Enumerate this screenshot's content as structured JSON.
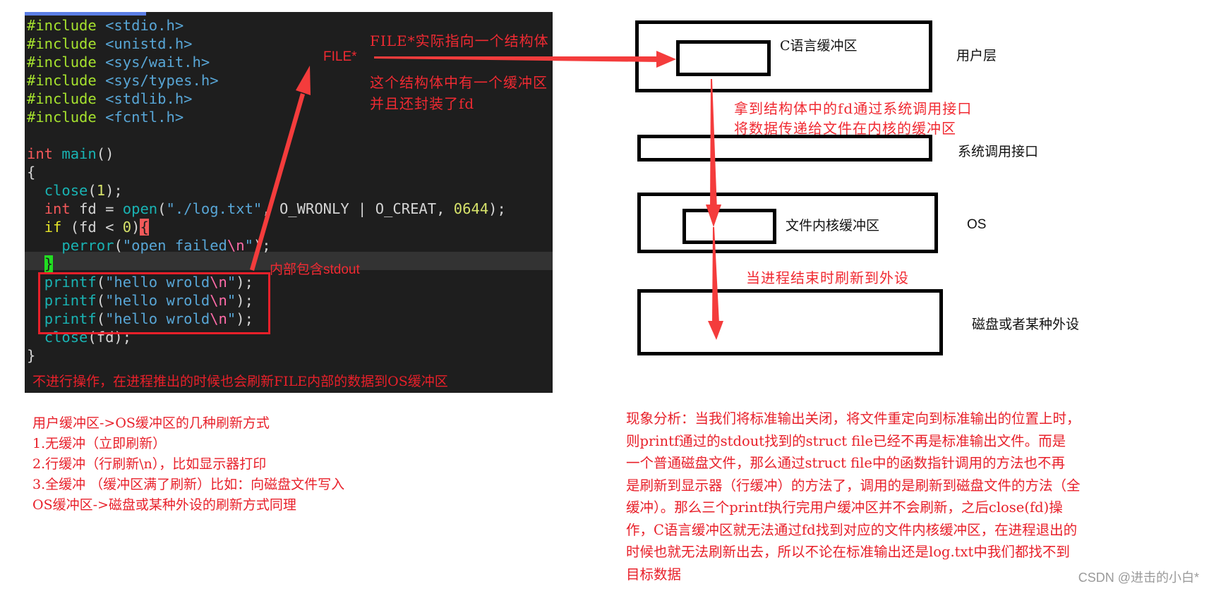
{
  "code": {
    "lines": [
      {
        "parts": [
          [
            "pp",
            "#include "
          ],
          [
            "hdr",
            "<stdio.h>"
          ]
        ]
      },
      {
        "parts": [
          [
            "pp",
            "#include "
          ],
          [
            "hdr",
            "<unistd.h>"
          ]
        ]
      },
      {
        "parts": [
          [
            "pp",
            "#include "
          ],
          [
            "hdr",
            "<sys/wait.h>"
          ]
        ]
      },
      {
        "parts": [
          [
            "pp",
            "#include "
          ],
          [
            "hdr",
            "<sys/types.h>"
          ]
        ]
      },
      {
        "parts": [
          [
            "pp",
            "#include "
          ],
          [
            "hdr",
            "<stdlib.h>"
          ]
        ]
      },
      {
        "parts": [
          [
            "pp",
            "#include "
          ],
          [
            "hdr",
            "<fcntl.h>"
          ]
        ]
      },
      {
        "parts": []
      },
      {
        "parts": [
          [
            "kw",
            "int "
          ],
          [
            "fn",
            "main"
          ],
          [
            "",
            "()"
          ]
        ]
      },
      {
        "parts": [
          [
            "",
            "{"
          ]
        ]
      },
      {
        "parts": [
          [
            "",
            "  "
          ],
          [
            "fn",
            "close"
          ],
          [
            "",
            "("
          ],
          [
            "num",
            "1"
          ],
          [
            "",
            ");"
          ]
        ]
      },
      {
        "parts": [
          [
            "",
            "  "
          ],
          [
            "kw",
            "int "
          ],
          [
            "",
            "fd = "
          ],
          [
            "fn",
            "open"
          ],
          [
            "",
            "("
          ],
          [
            "str",
            "\"./log.txt\""
          ],
          [
            "",
            ", O_WRONLY | O_CREAT, "
          ],
          [
            "num",
            "0644"
          ],
          [
            "",
            ");"
          ]
        ]
      },
      {
        "parts": [
          [
            "",
            "  "
          ],
          [
            "ctl",
            "if "
          ],
          [
            "",
            "(fd < "
          ],
          [
            "num",
            "0"
          ],
          [
            "",
            ")"
          ],
          [
            "brace-red",
            "{"
          ]
        ]
      },
      {
        "parts": [
          [
            "",
            "    "
          ],
          [
            "fn",
            "perror"
          ],
          [
            "",
            "("
          ],
          [
            "str",
            "\"open failed"
          ],
          [
            "esc",
            "\\n"
          ],
          [
            "str",
            "\""
          ],
          [
            "",
            ");"
          ]
        ]
      },
      {
        "parts": [
          [
            "",
            "  "
          ],
          [
            "brace-green",
            "}"
          ]
        ]
      },
      {
        "parts": [
          [
            "",
            "  "
          ],
          [
            "fn",
            "printf"
          ],
          [
            "",
            "("
          ],
          [
            "str",
            "\"hello wrold"
          ],
          [
            "esc",
            "\\n"
          ],
          [
            "str",
            "\""
          ],
          [
            "",
            ");"
          ]
        ]
      },
      {
        "parts": [
          [
            "",
            "  "
          ],
          [
            "fn",
            "printf"
          ],
          [
            "",
            "("
          ],
          [
            "str",
            "\"hello wrold"
          ],
          [
            "esc",
            "\\n"
          ],
          [
            "str",
            "\""
          ],
          [
            "",
            ");"
          ]
        ]
      },
      {
        "parts": [
          [
            "",
            "  "
          ],
          [
            "fn",
            "printf"
          ],
          [
            "",
            "("
          ],
          [
            "str",
            "\"hello wrold"
          ],
          [
            "esc",
            "\\n"
          ],
          [
            "str",
            "\""
          ],
          [
            "",
            ");"
          ]
        ]
      },
      {
        "parts": [
          [
            "",
            "  "
          ],
          [
            "fn",
            "close"
          ],
          [
            "",
            "(fd);"
          ]
        ]
      },
      {
        "parts": [
          [
            "",
            "}"
          ]
        ]
      }
    ]
  },
  "annotations": {
    "file_ptr": "FILE*",
    "file_struct_title": "FILE*实际指向一个结构体",
    "file_struct_desc1": "这个结构体中有一个缓冲区",
    "file_struct_desc2": "并且还封装了fd",
    "contains_stdout": "内部包含stdout"
  },
  "diagram": {
    "c_buffer_label": "C语言缓冲区",
    "user_layer": "用户层",
    "syscall_note1": "拿到结构体中的fd通过系统调用接口",
    "syscall_note2": "将数据传递给文件在内核的缓冲区",
    "syscall_layer": "系统调用接口",
    "kernel_buffer_label": "文件内核缓冲区",
    "os_layer": "OS",
    "flush_note": "当进程结束时刷新到外设",
    "device_layer": "磁盘或者某种外设"
  },
  "notes_left": {
    "line1": "不进行操作，在进程推出的时候也会刷新FILE内部的数据到OS缓冲区",
    "heading": "用户缓冲区->OS缓冲区的几种刷新方式",
    "item1": "1.无缓冲（立即刷新）",
    "item2": "2.行缓冲（行刷新\\n），比如显示器打印",
    "item3": "3.全缓冲 （缓冲区满了刷新）比如：向磁盘文件写入",
    "footer": "OS缓冲区->磁盘或某种外设的刷新方式同理"
  },
  "analysis": {
    "lines": [
      "现象分析：当我们将标准输出关闭，将文件重定向到标准输出的位置上时，",
      "则printf通过的stdout找到的struct file已经不再是标准输出文件。而是",
      "一个普通磁盘文件，那么通过struct file中的函数指针调用的方法也不再",
      "是刷新到显示器（行缓冲）的方法了，调用的是刷新到磁盘文件的方法（全",
      "缓冲）。那么三个printf执行完用户缓冲区并不会刷新，之后close(fd)操",
      "作，C语言缓冲区就无法通过fd找到对应的文件内核缓冲区，在进程退出的",
      "时候也就无法刷新出去，所以不论在标准输出还是log.txt中我们都找不到",
      "目标数据"
    ]
  },
  "watermark": "CSDN @进击的小白*",
  "colors": {
    "annotation_red": "#f02a32",
    "editor_bg": "#1e1e1e",
    "box_black": "#000000"
  }
}
